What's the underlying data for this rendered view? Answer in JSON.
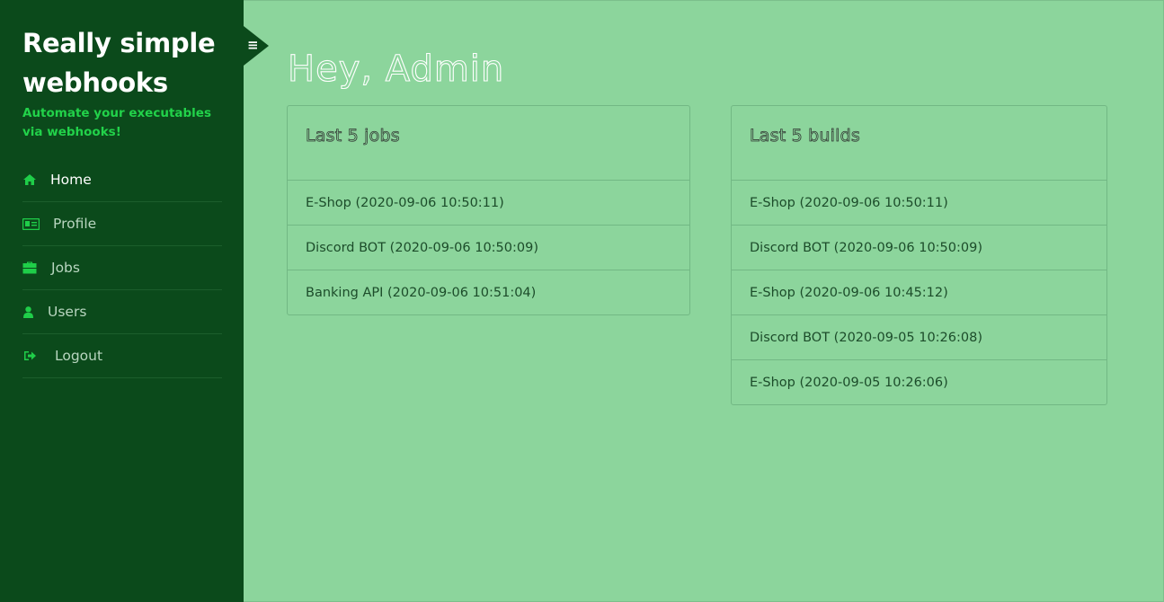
{
  "brand": {
    "title": "Really simple webhooks",
    "subtitle": "Automate your executables via webhooks!"
  },
  "nav": [
    {
      "label": "Home",
      "icon": "home-icon"
    },
    {
      "label": "Profile",
      "icon": "id-card-icon"
    },
    {
      "label": "Jobs",
      "icon": "briefcase-icon"
    },
    {
      "label": "Users",
      "icon": "user-icon"
    },
    {
      "label": "Logout",
      "icon": "sign-out-icon"
    }
  ],
  "toggle": {
    "icon": "menu-icon",
    "glyph": "≡"
  },
  "main": {
    "greeting": "Hey, Admin",
    "jobs": {
      "title": "Last 5 jobs",
      "items": [
        "E-Shop (2020-09-06 10:50:11)",
        "Discord BOT (2020-09-06 10:50:09)",
        "Banking API (2020-09-06 10:51:04)"
      ]
    },
    "builds": {
      "title": "Last 5 builds",
      "items": [
        "E-Shop (2020-09-06 10:50:11)",
        "Discord BOT (2020-09-06 10:50:09)",
        "E-Shop (2020-09-06 10:45:12)",
        "Discord BOT (2020-09-05 10:26:08)",
        "E-Shop (2020-09-05 10:26:06)"
      ]
    }
  },
  "colors": {
    "sidebar": "#0b4a1b",
    "background": "#8cd59c",
    "accent": "#22d24a"
  }
}
